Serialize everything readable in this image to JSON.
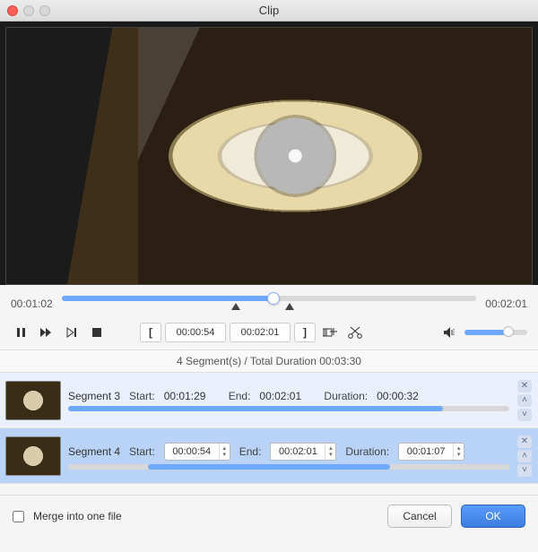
{
  "window": {
    "title": "Clip"
  },
  "player": {
    "current_time": "00:01:02",
    "end_time": "00:02:01",
    "progress_pct": 51,
    "marker_in_pct": 42,
    "marker_out_pct": 55,
    "bracket_start": "00:00:54",
    "bracket_end": "00:02:01",
    "volume_pct": 70
  },
  "segments_summary": "4 Segment(s) / Total Duration 00:03:30",
  "labels": {
    "start": "Start:",
    "end": "End:",
    "duration": "Duration:",
    "merge": "Merge into one file",
    "cancel": "Cancel",
    "ok": "OK"
  },
  "segments": [
    {
      "name": "Segment 3",
      "start": "00:01:29",
      "end": "00:02:01",
      "duration": "00:00:32",
      "selected": false,
      "bar_left_pct": 0,
      "bar_width_pct": 85,
      "editable": false
    },
    {
      "name": "Segment 4",
      "start": "00:00:54",
      "end": "00:02:01",
      "duration": "00:01:07",
      "selected": true,
      "bar_left_pct": 18,
      "bar_width_pct": 55,
      "editable": true
    }
  ],
  "merge_checked": false
}
